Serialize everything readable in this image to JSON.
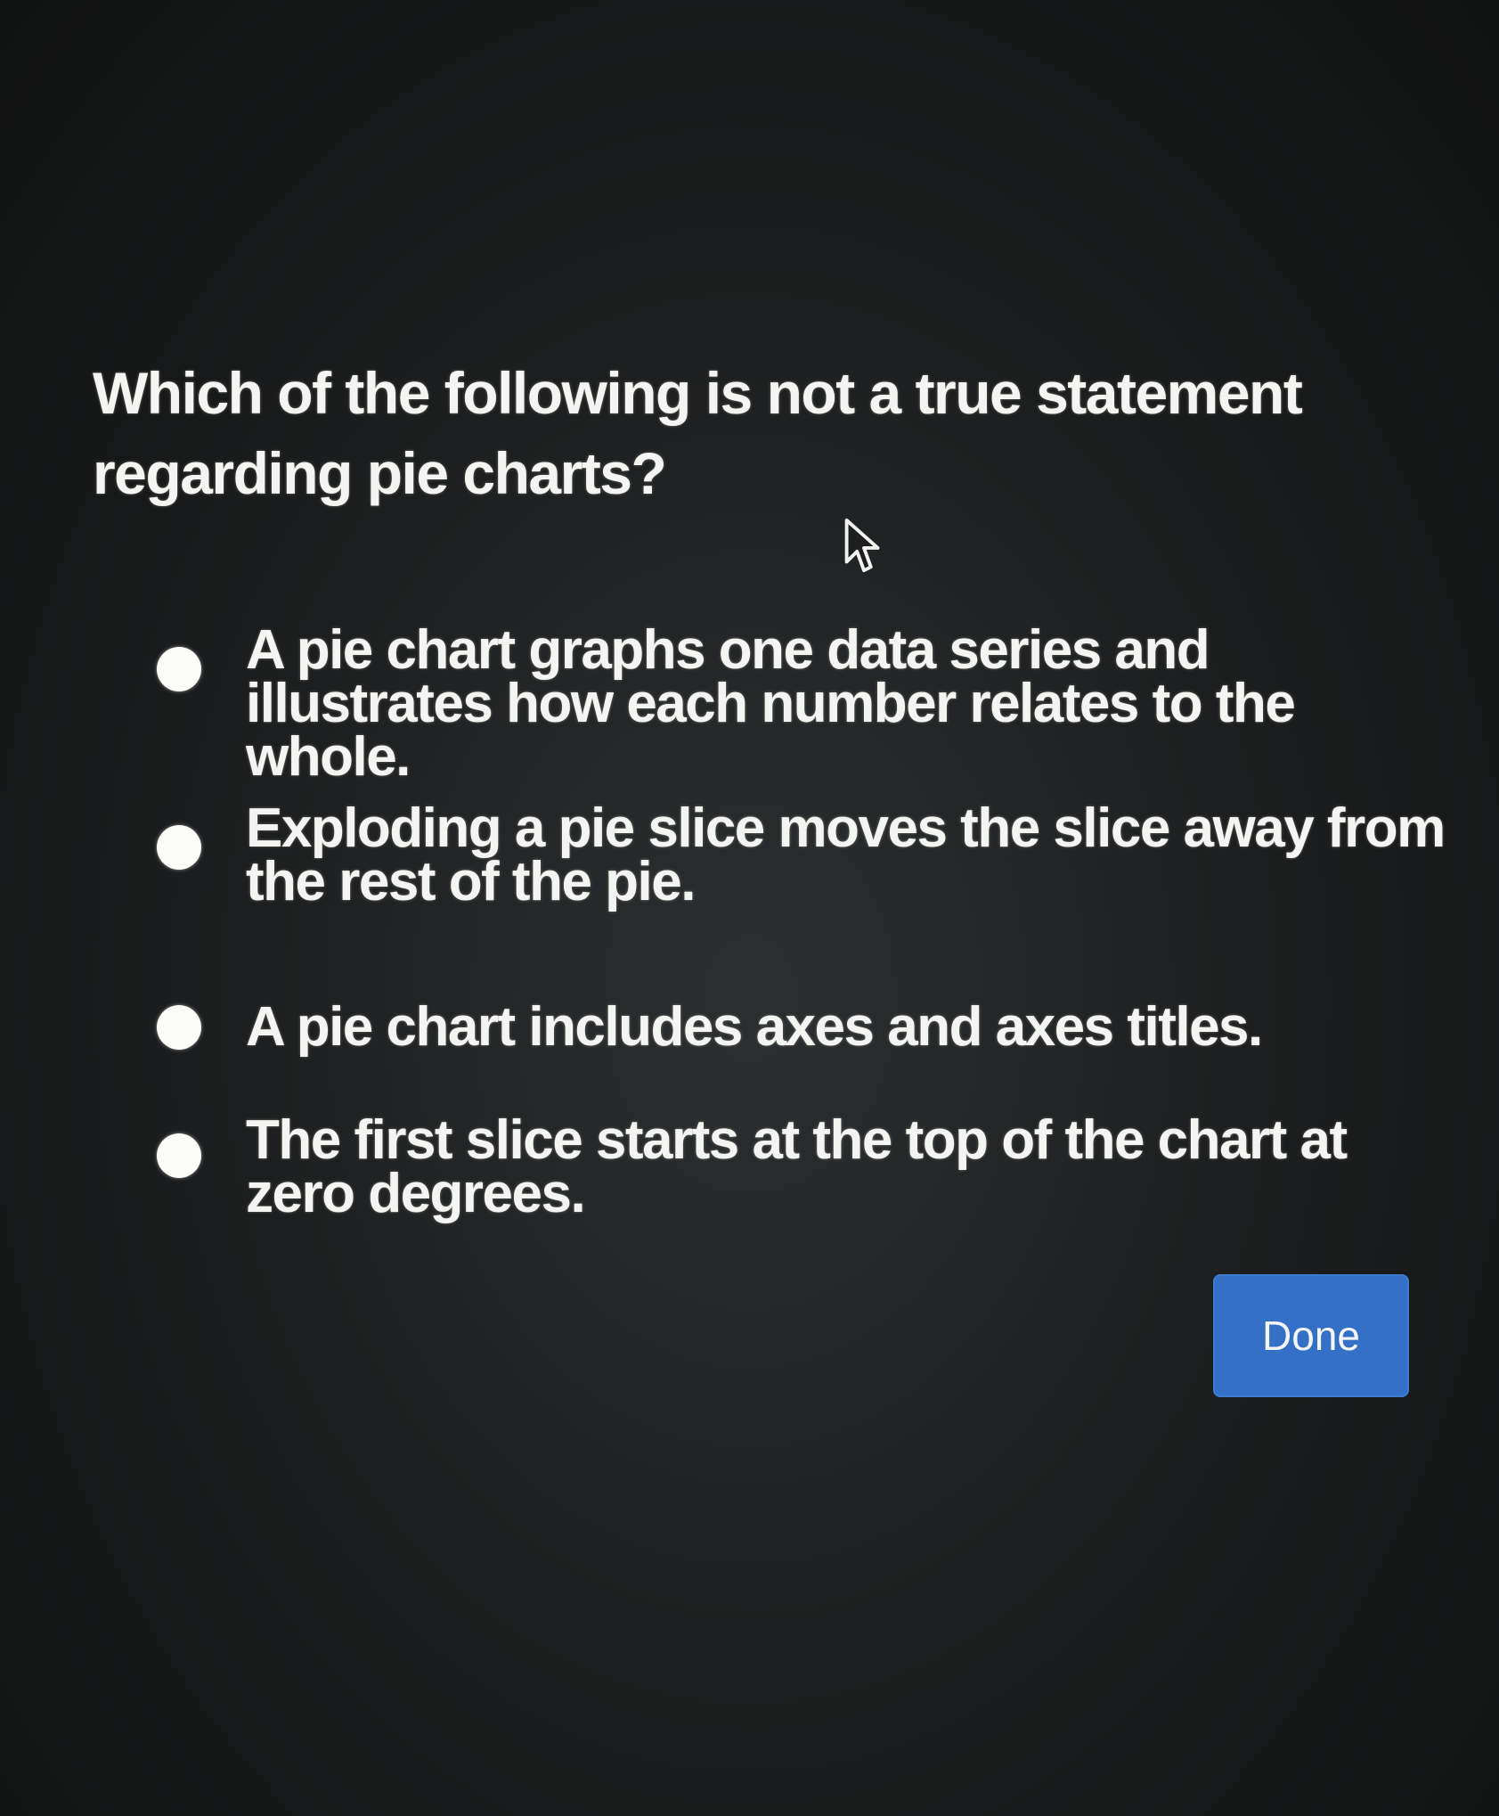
{
  "question": {
    "text": "Which of the following is not a true statement regarding pie charts?"
  },
  "cursor": {
    "icon": "mouse-pointer-icon"
  },
  "options": [
    {
      "label": "A pie chart graphs one data series and illustrates how each number relates to the whole."
    },
    {
      "label": "Exploding a pie slice moves the slice away from the rest of the pie."
    },
    {
      "label": "A pie chart includes axes and axes titles."
    },
    {
      "label": "The first slice starts at the top of the chart at zero degrees."
    }
  ],
  "done_button": {
    "label": "Done",
    "color": "#3470c6"
  }
}
